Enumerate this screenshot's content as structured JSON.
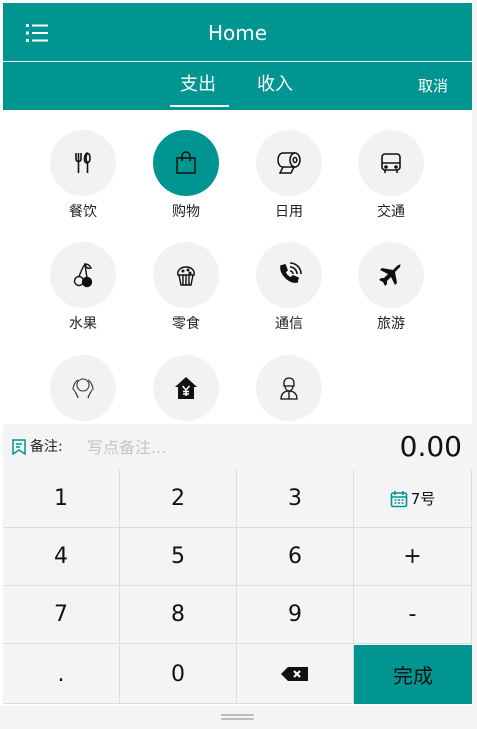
{
  "header": {
    "title": "Home",
    "menu_icon": "list-icon"
  },
  "tabs": {
    "expense": "支出",
    "income": "收入",
    "cancel": "取消"
  },
  "colors": {
    "primary": "#009591",
    "panel": "#f4f4f4"
  },
  "categories": [
    {
      "label": "餐饮",
      "icon": "fork-knife-icon"
    },
    {
      "label": "购物",
      "icon": "shopping-bag-icon",
      "selected": true
    },
    {
      "label": "日用",
      "icon": "toilet-paper-icon"
    },
    {
      "label": "交通",
      "icon": "bus-icon"
    },
    {
      "label": "水果",
      "icon": "cherry-icon"
    },
    {
      "label": "零食",
      "icon": "cupcake-icon"
    },
    {
      "label": "通信",
      "icon": "phone-icon"
    },
    {
      "label": "旅游",
      "icon": "airplane-icon"
    },
    {
      "label": "",
      "icon": "hands-icon"
    },
    {
      "label": "",
      "icon": "house-yuan-icon"
    },
    {
      "label": "",
      "icon": "person-icon"
    }
  ],
  "note": {
    "label": "备注:",
    "placeholder": "写点备注...",
    "value": ""
  },
  "amount": "0.00",
  "keypad": {
    "keys": [
      "1",
      "2",
      "3",
      "7号",
      "4",
      "5",
      "6",
      "+",
      "7",
      "8",
      "9",
      "-",
      ".",
      "0",
      "⌫",
      "完成"
    ]
  }
}
